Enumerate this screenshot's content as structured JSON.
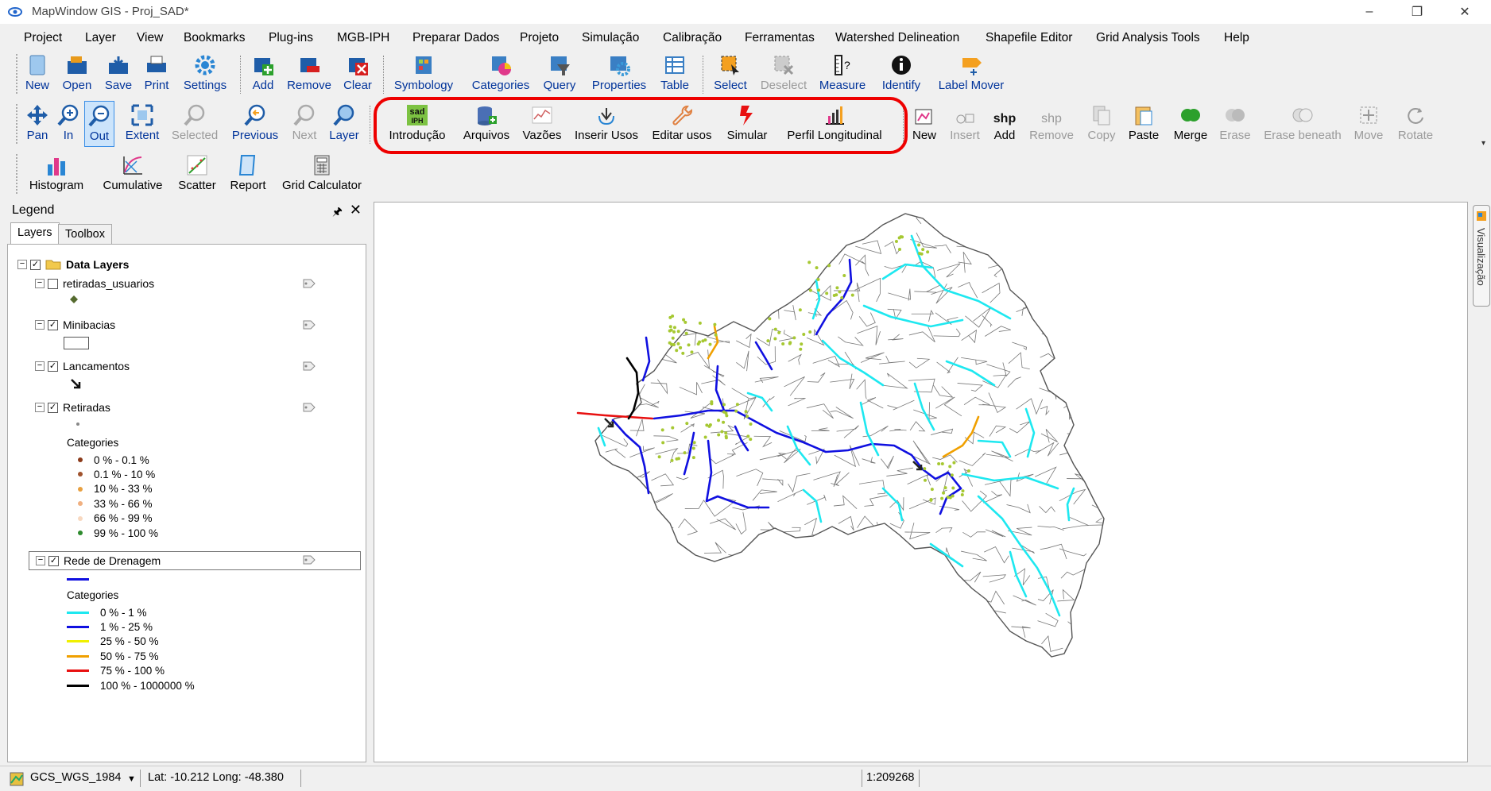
{
  "app": {
    "title": "MapWindow GIS  - Proj_SAD*"
  },
  "window_controls": {
    "minimize": "–",
    "restore": "❐",
    "close": "✕"
  },
  "menu": [
    "Project",
    "Layer",
    "View",
    "Bookmarks",
    "Plug-ins",
    "MGB-IPH",
    "Preparar Dados",
    "Projeto",
    "Simulação",
    "Calibração",
    "Ferramentas",
    "Watershed Delineation",
    "Shapefile Editor",
    "Grid Analysis Tools",
    "Help"
  ],
  "toolbar1": {
    "file": [
      "New",
      "Open",
      "Save",
      "Print",
      "Settings"
    ],
    "layer": [
      "Add",
      "Remove",
      "Clear"
    ],
    "symbology": [
      "Symbology",
      "Categories",
      "Query",
      "Properties",
      "Table"
    ],
    "select": [
      "Select",
      "Deselect",
      "Measure",
      "Identify",
      "Label Mover"
    ]
  },
  "toolbar2": {
    "nav": [
      "Pan",
      "In",
      "Out",
      "Extent",
      "Selected",
      "Previous",
      "Next",
      "Layer"
    ],
    "sad_icon_text": [
      "sad",
      "IPH"
    ],
    "sad": [
      "Introdução",
      "Arquivos",
      "Vazões",
      "Inserir Usos",
      "Editar usos",
      "Simular",
      "Perfil Longitudinal"
    ],
    "shp_icon_text": "shp",
    "shape": [
      "New",
      "Insert",
      "Add",
      "Remove",
      "Copy",
      "Paste",
      "Merge",
      "Erase",
      "Erase beneath",
      "Move",
      "Rotate"
    ]
  },
  "toolbar3": [
    "Histogram",
    "Cumulative",
    "Scatter",
    "Report",
    "Grid Calculator"
  ],
  "legend": {
    "title": "Legend",
    "pin": "🖈",
    "close": "✕",
    "tabs": [
      "Layers",
      "Toolbox"
    ],
    "group": "Data Layers",
    "layers": [
      {
        "name": "retiradas_usuarios",
        "checked": false
      },
      {
        "name": "Minibacias",
        "checked": true
      },
      {
        "name": "Lancamentos",
        "checked": true
      },
      {
        "name": "Retiradas",
        "checked": true
      },
      {
        "name": "Rede de Drenagem",
        "checked": true
      }
    ],
    "categories_label": "Categories",
    "retiradas_categories": [
      {
        "label": "0 % - 0.1 %",
        "color": "#8b3a1a"
      },
      {
        "label": "0.1 % - 10 %",
        "color": "#a0522d"
      },
      {
        "label": "10 % - 33 %",
        "color": "#e8a040"
      },
      {
        "label": "33 % - 66 %",
        "color": "#f0b080"
      },
      {
        "label": "66 % - 99 %",
        "color": "#f8d8c0"
      },
      {
        "label": "99 % - 100 %",
        "color": "#2e8b2e"
      }
    ],
    "rede_categories": [
      {
        "label": "0 % - 1 %",
        "color": "#1ee8f0"
      },
      {
        "label": "1 % - 25 %",
        "color": "#1010e0"
      },
      {
        "label": "25 % - 50 %",
        "color": "#f0f000"
      },
      {
        "label": "50 % - 75 %",
        "color": "#f0a000"
      },
      {
        "label": "75 % - 100 %",
        "color": "#e81010"
      },
      {
        "label": "100 % - 1000000 %",
        "color": "#000000"
      }
    ]
  },
  "side_tab": "Visualização",
  "status": {
    "crs": "GCS_WGS_1984",
    "coords": "Lat: -10.212 Long: -48.380",
    "scale": "1:209268"
  }
}
